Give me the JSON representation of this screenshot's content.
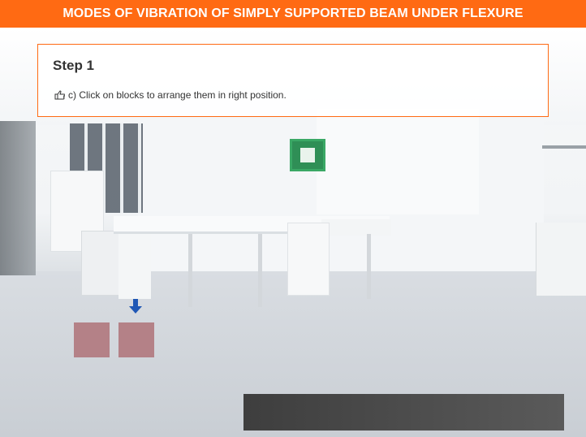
{
  "header": {
    "title": "MODES OF VIBRATION OF SIMPLY SUPPORTED BEAM UNDER FLEXURE"
  },
  "panel": {
    "step_title": "Step 1",
    "instruction": "c) Click on blocks to arrange them in right position.",
    "icon": "hand-point-right-icon"
  },
  "blocks": {
    "count": 2,
    "color": "#b48187"
  },
  "colors": {
    "accent": "#ff6a13",
    "arrow": "#1f57b5",
    "block": "#b48187"
  }
}
